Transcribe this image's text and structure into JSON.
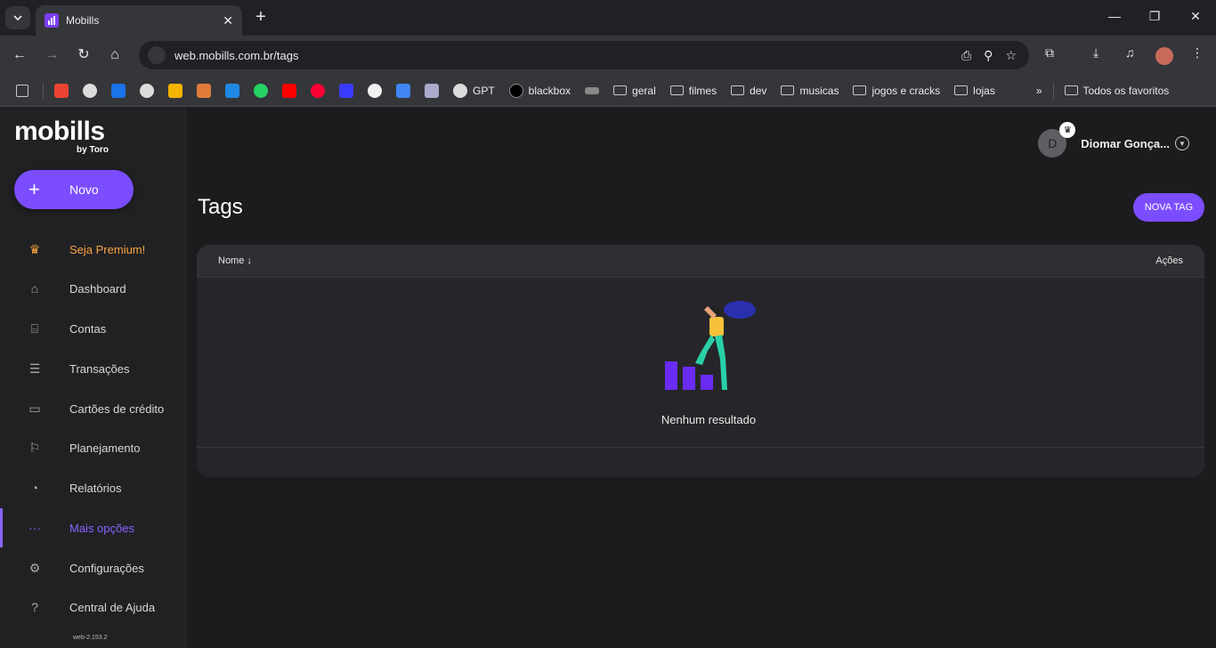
{
  "browser": {
    "tab_title": "Mobills",
    "url": "web.mobills.com.br/tags",
    "bookmarks": [
      "GPT",
      "blackbox",
      "geral",
      "filmes",
      "dev",
      "musicas",
      "jogos e cracks",
      "lojas"
    ],
    "all_bookmarks": "Todos os favoritos"
  },
  "sidebar": {
    "logo": "mobills",
    "logo_sub": "by Toro",
    "new_button": "Novo",
    "items": [
      {
        "label": "Seja Premium!",
        "icon": "crown-icon"
      },
      {
        "label": "Dashboard",
        "icon": "home-icon"
      },
      {
        "label": "Contas",
        "icon": "bank-icon"
      },
      {
        "label": "Transações",
        "icon": "list-icon"
      },
      {
        "label": "Cartões de crédito",
        "icon": "card-icon"
      },
      {
        "label": "Planejamento",
        "icon": "flag-icon"
      },
      {
        "label": "Relatórios",
        "icon": "pie-chart-icon"
      },
      {
        "label": "Mais opções",
        "icon": "more-icon"
      },
      {
        "label": "Configurações",
        "icon": "gear-icon"
      },
      {
        "label": "Central de Ajuda",
        "icon": "help-icon"
      }
    ],
    "version": "web-2.153.2"
  },
  "header": {
    "avatar_initial": "D",
    "user_name": "Diomar Gonça..."
  },
  "page": {
    "title": "Tags",
    "new_tag_button": "NOVA TAG",
    "table": {
      "col_name": "Nome",
      "col_actions": "Ações",
      "empty_text": "Nenhum resultado"
    }
  },
  "colors": {
    "accent": "#7b4dff",
    "premium": "#f7a440"
  }
}
